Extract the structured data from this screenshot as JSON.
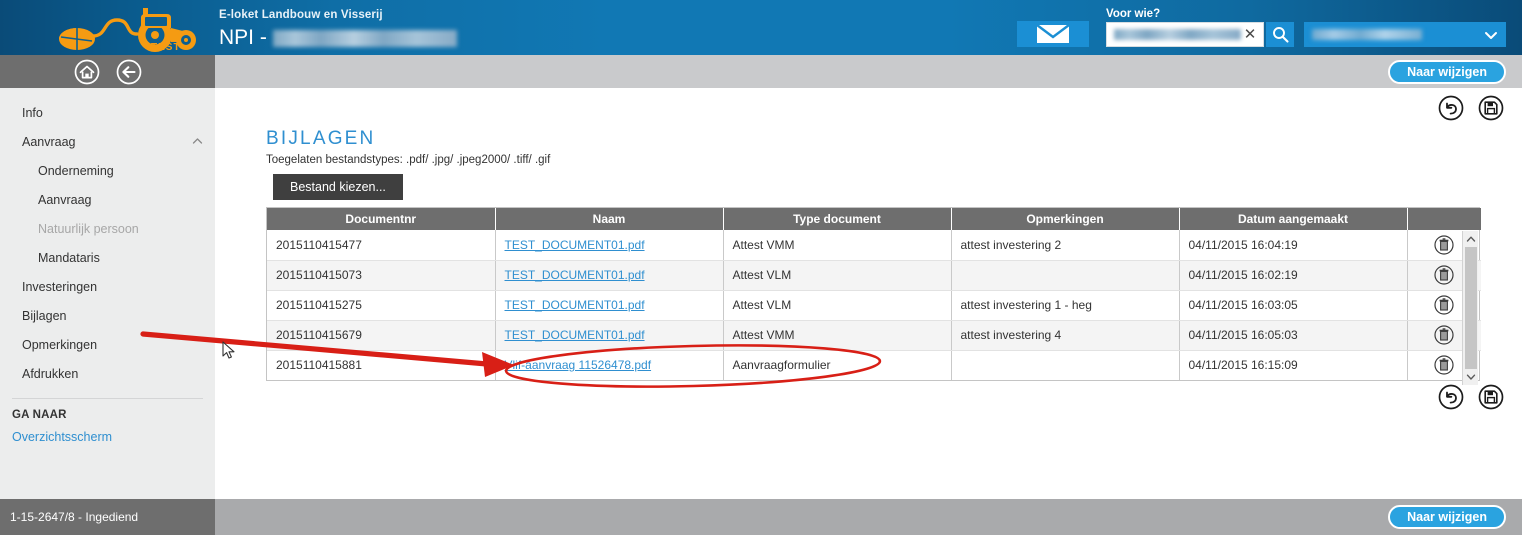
{
  "header": {
    "logo_icon": "tractor-mouse-logo",
    "logo_badge": "TEST",
    "subtitle": "E-loket Landbouw en Visserij",
    "title_prefix": "NPI -",
    "title_value_redacted": true,
    "mail_icon": "envelope-icon",
    "search": {
      "label": "Voor wie?",
      "value_redacted": true,
      "clear_icon": "close-icon",
      "search_icon": "search-icon"
    },
    "account_select": {
      "value_redacted": true,
      "chevron_icon": "chevron-down-icon"
    }
  },
  "navbar": {
    "home_icon": "home-icon",
    "back_icon": "back-arrow-icon",
    "action_label": "Naar wijzigen"
  },
  "sidebar": {
    "items": [
      {
        "label": "Info",
        "level": 0,
        "disabled": false,
        "caret": false
      },
      {
        "label": "Aanvraag",
        "level": 0,
        "disabled": false,
        "caret": true
      },
      {
        "label": "Onderneming",
        "level": 1,
        "disabled": false,
        "caret": false
      },
      {
        "label": "Aanvraag",
        "level": 1,
        "disabled": false,
        "caret": false
      },
      {
        "label": "Natuurlijk persoon",
        "level": 1,
        "disabled": true,
        "caret": false
      },
      {
        "label": "Mandataris",
        "level": 1,
        "disabled": false,
        "caret": false
      },
      {
        "label": "Investeringen",
        "level": 0,
        "disabled": false,
        "caret": false
      },
      {
        "label": "Bijlagen",
        "level": 0,
        "disabled": false,
        "caret": false
      },
      {
        "label": "Opmerkingen",
        "level": 0,
        "disabled": false,
        "caret": false
      },
      {
        "label": "Afdrukken",
        "level": 0,
        "disabled": false,
        "caret": false
      }
    ],
    "go_to_heading": "GA NAAR",
    "go_to_link": "Overzichtsscherm"
  },
  "main": {
    "page_title": "BIJLAGEN",
    "file_types_note": "Toegelaten bestandstypes: .pdf/ .jpg/ .jpeg2000/ .tiff/ .gif",
    "choose_file_button": "Bestand kiezen...",
    "undo_icon": "undo-icon",
    "save_icon": "save-icon",
    "table": {
      "columns": [
        "Documentnr",
        "Naam",
        "Type document",
        "Opmerkingen",
        "Datum aangemaakt",
        ""
      ],
      "rows": [
        {
          "documentnr": "2015110415477",
          "naam": "TEST_DOCUMENT01.pdf",
          "type": "Attest VMM",
          "opmerkingen": "attest investering 2",
          "datum": "04/11/2015 16:04:19",
          "delete_icon": "trash-icon"
        },
        {
          "documentnr": "2015110415073",
          "naam": "TEST_DOCUMENT01.pdf",
          "type": "Attest VLM",
          "opmerkingen": "",
          "datum": "04/11/2015 16:02:19",
          "delete_icon": "trash-icon"
        },
        {
          "documentnr": "2015110415275",
          "naam": "TEST_DOCUMENT01.pdf",
          "type": "Attest VLM",
          "opmerkingen": "attest investering 1 - heg",
          "datum": "04/11/2015 16:03:05",
          "delete_icon": "trash-icon"
        },
        {
          "documentnr": "2015110415679",
          "naam": "TEST_DOCUMENT01.pdf",
          "type": "Attest VMM",
          "opmerkingen": "attest investering 4",
          "datum": "04/11/2015 16:05:03",
          "delete_icon": "trash-icon"
        },
        {
          "documentnr": "2015110415881",
          "naam": "Vlif-aanvraag 11526478.pdf",
          "type": "Aanvraagformulier",
          "opmerkingen": "",
          "datum": "04/11/2015 16:15:09",
          "delete_icon": "trash-icon"
        }
      ],
      "scroll_up_icon": "chevron-up-icon",
      "scroll_down_icon": "chevron-down-icon"
    }
  },
  "footer": {
    "status": "1-15-2647/8 - Ingediend",
    "action_label": "Naar wijzigen"
  },
  "annotation": {
    "arrow_icon": "red-arrow-annotation",
    "ellipse_icon": "red-ellipse-annotation",
    "color": "#D81F16"
  },
  "colors": {
    "brand_blue": "#1178b4",
    "accent_blue": "#2aa3e0",
    "link_blue": "#2f8fd0",
    "header_gray": "#6e6e6e",
    "nav_gray": "#c9cacc",
    "sidebar_gray": "#eceded",
    "dark_button": "#3f3f3f",
    "logo_orange": "#F59B12"
  }
}
